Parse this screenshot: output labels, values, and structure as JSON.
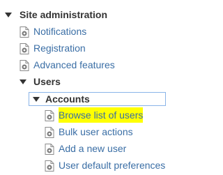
{
  "tree": {
    "site_administration": {
      "label": "Site administration",
      "items": [
        {
          "label": "Notifications"
        },
        {
          "label": "Registration"
        },
        {
          "label": "Advanced features"
        }
      ]
    },
    "users": {
      "label": "Users",
      "accounts": {
        "label": "Accounts",
        "items": [
          {
            "label": "Browse list of users",
            "highlighted": true
          },
          {
            "label": "Bulk user actions"
          },
          {
            "label": "Add a new user"
          },
          {
            "label": "User default preferences"
          }
        ]
      }
    }
  },
  "icons": {
    "expanded": "triangle-down-icon",
    "leaf": "settings-page-icon"
  },
  "colors": {
    "link": "#3a6ea5",
    "highlight": "#ffff00",
    "focus_border": "#8ab4e8"
  }
}
